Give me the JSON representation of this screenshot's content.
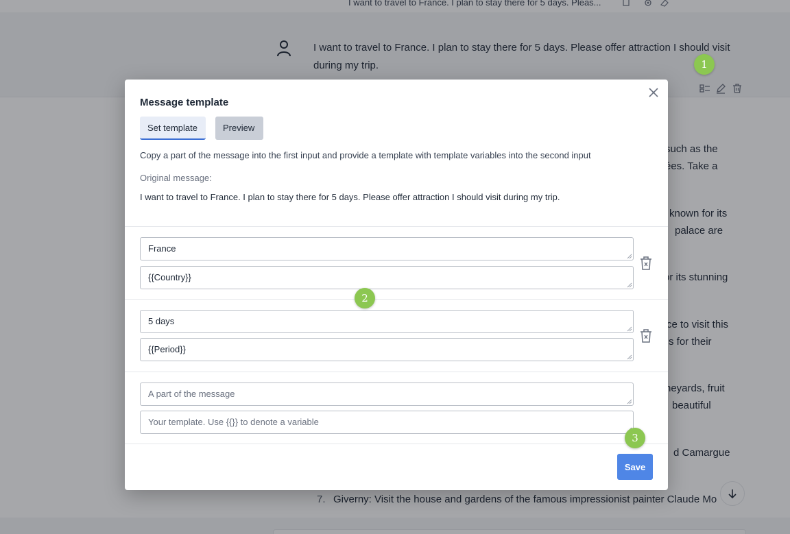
{
  "chat": {
    "previous_message_truncated": "I want to travel to France. I plan to stay there for 5 days. Pleas...",
    "user_message": "I want to travel to France. I plan to stay there for 5 days. Please offer attraction I should visit during my trip.",
    "row_action_icons": [
      "template-icon",
      "edit-icon",
      "trash-icon"
    ],
    "assistant_fragments": [
      {
        "text": "such as the"
      },
      {
        "text": "ées. Take a"
      },
      {
        "text": "known for its"
      },
      {
        "text": "palace are"
      },
      {
        "text": "or its stunning"
      },
      {
        "text": "ce to visit this"
      },
      {
        "text": "s for their"
      },
      {
        "text": "neyards, fruit"
      },
      {
        "text": "beautiful"
      },
      {
        "text": "d Camargue"
      }
    ],
    "list_item": {
      "number": "7.",
      "text": "Giverny: Visit the house and gardens of the famous impressionist painter Claude Mo"
    }
  },
  "modal": {
    "title": "Message template",
    "tabs": [
      {
        "label": "Set template",
        "active": true
      },
      {
        "label": "Preview",
        "active": false
      }
    ],
    "description": "Copy a part of the message into the first input and provide a template with template variables into the second input",
    "original_message_label": "Original message:",
    "original_message": "I want to travel to France. I plan to stay there for 5 days. Please offer attraction I should visit during my trip.",
    "pairs": [
      {
        "part": "France",
        "template": "{{Country}}"
      },
      {
        "part": "5 days",
        "template": "{{Period}}"
      }
    ],
    "new_pair": {
      "part_placeholder": "A part of the message",
      "template_placeholder": "Your template. Use {{}} to denote a variable"
    },
    "save_label": "Save"
  },
  "badges": [
    "1",
    "2",
    "3"
  ],
  "colors": {
    "accent": "#4f86e6",
    "badge": "#8cc751",
    "tab_active_bg": "#e8edf7",
    "tab_inactive_bg": "#c9ced7"
  }
}
